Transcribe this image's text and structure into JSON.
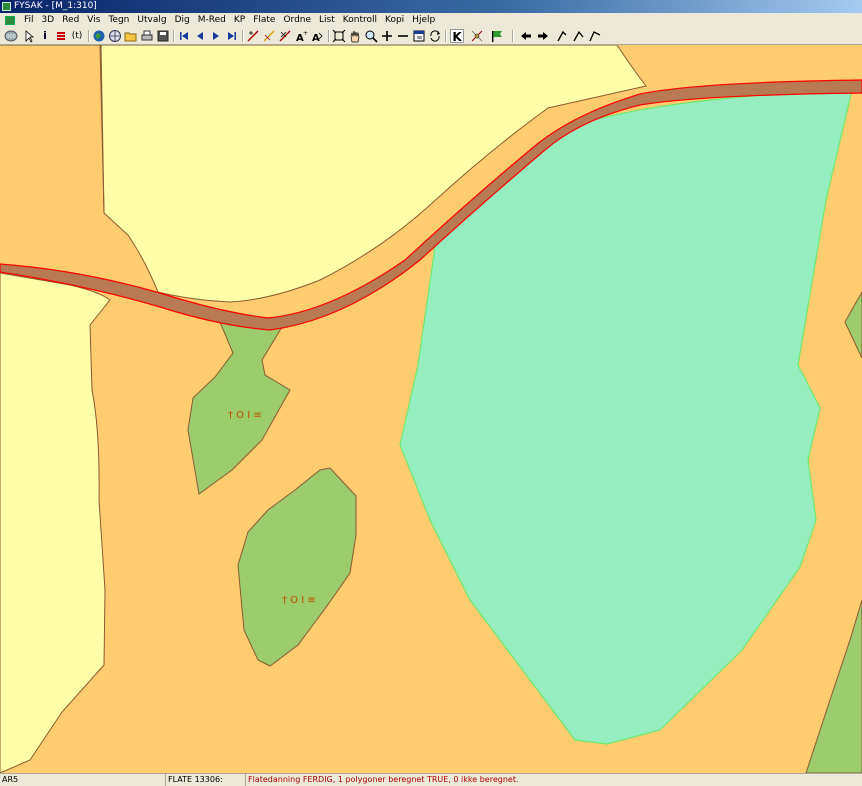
{
  "window": {
    "title": "FYSAK - [M_1:310]"
  },
  "menu": [
    "Fil",
    "3D",
    "Red",
    "Vis",
    "Tegn",
    "Utvalg",
    "Dig",
    "M-Red",
    "KP",
    "Flate",
    "Ordne",
    "List",
    "Kontroll",
    "Kopi",
    "Hjelp"
  ],
  "toolbar": {
    "info_label": "i",
    "t_label": "(t)",
    "k_label": "K"
  },
  "map": {
    "symbols": [
      "† O I ≡",
      "† O I ≡"
    ],
    "colors": {
      "background_orange": "#ffcc70",
      "light_yellow": "#ffffa8",
      "road_brown": "#b87a52",
      "road_outline": "#ff0000",
      "green_patch": "#9ccc6c",
      "mint_area": "#96eec0",
      "mint_outline": "#6ee86e"
    }
  },
  "status": {
    "left": "AR5",
    "middle": "FLATE 13306:",
    "message": "Flatedanning FERDIG, 1 polygoner beregnet TRUE, 0 ikke beregnet."
  }
}
